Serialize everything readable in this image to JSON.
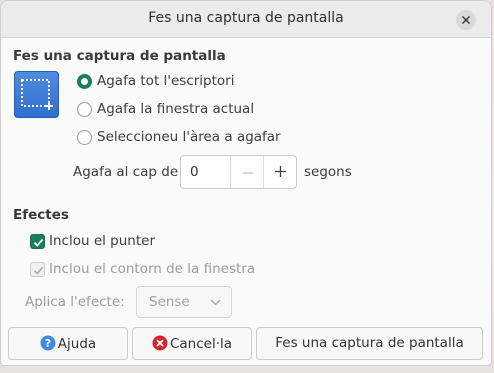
{
  "window": {
    "title": "Fes una captura de pantalla"
  },
  "capture": {
    "section_title": "Fes una captura de pantalla",
    "options": [
      {
        "label": "Agafa tot l'escriptori",
        "selected": true
      },
      {
        "label": "Agafa la finestra actual",
        "selected": false
      },
      {
        "label": "Seleccioneu l'àrea a agafar",
        "selected": false
      }
    ],
    "delay_prefix": "Agafa al cap de",
    "delay_value": "0",
    "delay_suffix": "segons"
  },
  "effects": {
    "section_title": "Efectes",
    "include_pointer": {
      "label": "Inclou el punter",
      "checked": true
    },
    "include_border": {
      "label": "Inclou el contorn de la finestra",
      "checked": true,
      "disabled": true
    },
    "apply_effect_label": "Aplica l'efecte:",
    "apply_effect_value": "Sense"
  },
  "buttons": {
    "help": "Ajuda",
    "cancel": "Cancel·la",
    "take": "Fes una captura de pantalla"
  },
  "colors": {
    "accent": "#1a7f5a",
    "help_icon": "#3d8be0",
    "cancel_icon": "#d0262d"
  },
  "icons": {
    "close": "close-icon",
    "screenshot": "screenshot-area-icon",
    "help": "help-icon",
    "cancel": "cancel-icon"
  }
}
